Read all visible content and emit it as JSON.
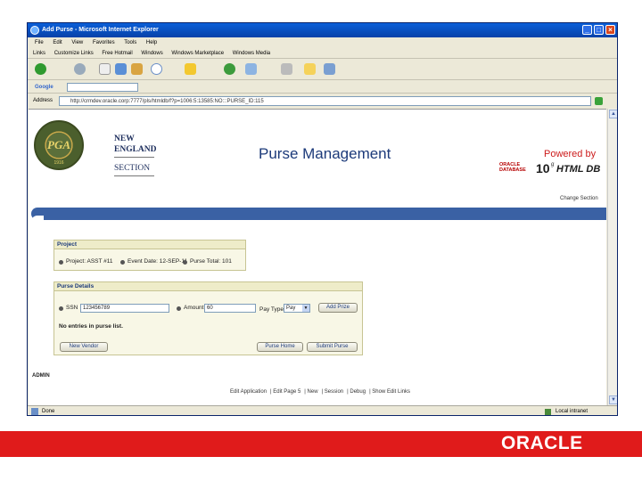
{
  "window": {
    "title": "Add Purse - Microsoft Internet Explorer",
    "menu": [
      "File",
      "Edit",
      "View",
      "Favorites",
      "Tools",
      "Help"
    ],
    "links_bar": [
      "Links",
      "Customize Links",
      "Free Hotmail",
      "Windows",
      "Windows Marketplace",
      "Windows Media"
    ],
    "google_label": "Google",
    "address": "http://crmdev.oracle.corp:7777/pls/htmldb/f?p=1006:5:13585:NO:::PURSE_ID:115",
    "status_text": "Done",
    "zone_text": "Local intranet"
  },
  "header": {
    "logo_text": "PGA",
    "logo_year": "1916",
    "section_line1": "NEW ENGLAND",
    "section_line2": "SECTION",
    "app_title": "Purse Management",
    "powered_by": "Powered by",
    "oracle_small": "ORACLE\nDATABASE",
    "ten": "10",
    "g": "g",
    "htmldb": "HTML DB",
    "change_section": "Change Section"
  },
  "project": {
    "title": "Project",
    "items": [
      "Project: ASST #11",
      "Event Date: 12-SEP-11",
      "Purse Total: 101"
    ]
  },
  "purse": {
    "title": "Purse Details",
    "ssn_label": "SSN",
    "ssn_value": "123456789",
    "amount_label": "Amount",
    "amount_value": "60",
    "paytype_label": "Pay Type",
    "paytype_value": "Pay",
    "add_prize": "Add Prize",
    "no_entries": "No entries in purse list.",
    "new_vendor": "New Vendor",
    "purse_home": "Purse Home",
    "submit_purse": "Submit Purse"
  },
  "footer": {
    "user": "ADMIN",
    "links": [
      "Edit Application",
      "Edit Page 5",
      "New",
      "Session",
      "Debug",
      "Show Edit Links"
    ]
  },
  "slide": {
    "oracle_logo": "ORACLE"
  }
}
